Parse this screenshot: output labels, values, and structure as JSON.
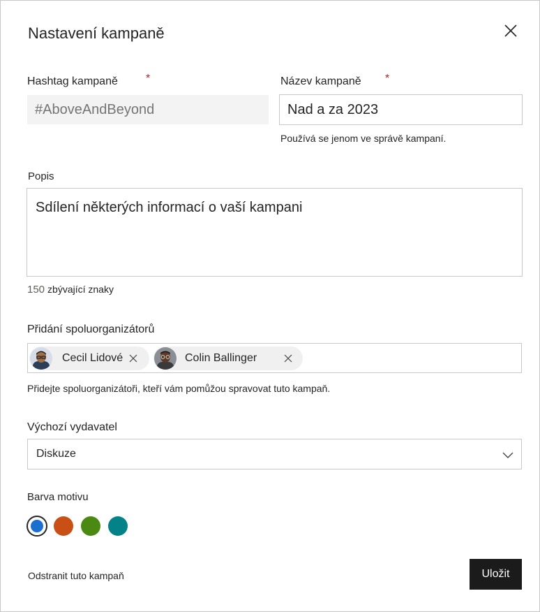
{
  "dialog": {
    "title": "Nastavení kampaně"
  },
  "hashtag": {
    "label": "Hashtag kampaně",
    "required_mark": "*",
    "placeholder": "#AboveAndBeyond"
  },
  "name": {
    "label": "Název kampaně",
    "required_mark": "*",
    "value": "Nad a za 2023",
    "helper": "Používá se jenom ve správě kampaní."
  },
  "description": {
    "label": "Popis",
    "value": "Sdílení některých informací o vaší kampani",
    "remaining_count": "150",
    "remaining_label": "zbývající znaky"
  },
  "coorganizers": {
    "label": "Přidání spoluorganizátorů",
    "people": [
      {
        "name": "Cecil  Lidové"
      },
      {
        "name": "Colin Ballinger"
      }
    ],
    "helper": "Přidejte spoluorganizátoři, kteří vám pomůžou spravovat tuto kampaň."
  },
  "publisher": {
    "label": "Výchozí vydavatel",
    "selected": "Diskuze"
  },
  "theme": {
    "label": "Barva motivu",
    "colors": [
      {
        "name": "blue",
        "hex": "#1b6fd0",
        "selected": true
      },
      {
        "name": "orange",
        "hex": "#ca4f14",
        "selected": false
      },
      {
        "name": "green",
        "hex": "#4a8a12",
        "selected": false
      },
      {
        "name": "teal",
        "hex": "#038387",
        "selected": false
      }
    ]
  },
  "footer": {
    "delete_label": "Odstranit tuto kampaň",
    "save_label": "Uložit"
  }
}
